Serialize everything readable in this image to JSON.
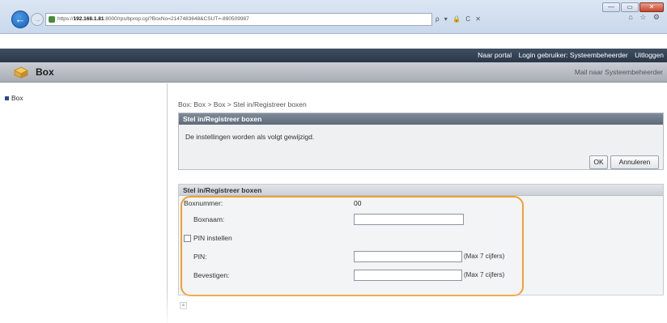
{
  "browser": {
    "url_host": "192.168.1.81",
    "url_prefix": "https://",
    "url_rest": ":8000/rps/bprop.cgi?BoxNo=2147483648&CSUT=-890509987",
    "toolbar_icons": "ρ ▾ 🔒 C ✕",
    "home_icons": "⌂ ☆ ⚙",
    "window_controls": {
      "minimize": "—",
      "maximize": "▭",
      "close": "✕"
    }
  },
  "header": {
    "portal_link": "Naar portal",
    "login_user": "Login gebruiker: Systeembeheerder",
    "logout_link": "Uitloggen"
  },
  "title_bar": {
    "title": "Box",
    "mail_link": "Mail naar Systeembeheerder"
  },
  "sidebar": {
    "items": [
      {
        "label": "Box"
      }
    ]
  },
  "main": {
    "breadcrumb": "Box: Box > Box > Stel in/Registreer boxen",
    "confirm_panel": {
      "title": "Stel in/Registreer boxen",
      "message": "De instellingen worden als volgt gewijzigd.",
      "ok_label": "OK",
      "cancel_label": "Annuleren"
    },
    "form_panel": {
      "title": "Stel in/Registreer boxen",
      "box_number_label": "Boxnummer:",
      "box_number_value": "00",
      "box_name_label": "Boxnaam:",
      "box_name_value": "",
      "pin_checkbox_label": "PIN instellen",
      "pin_checked": false,
      "pin_label": "PIN:",
      "pin_value": "",
      "pin_hint": "(Max 7 cijfers)",
      "confirm_label": "Bevestigen:",
      "confirm_value": "",
      "confirm_hint": "(Max 7 cijfers)"
    }
  },
  "colors": {
    "header_bg": "#2b3748",
    "panel_head": "#5f6b7a",
    "highlight": "#f0a030",
    "back_button": "#1a5fb4"
  }
}
